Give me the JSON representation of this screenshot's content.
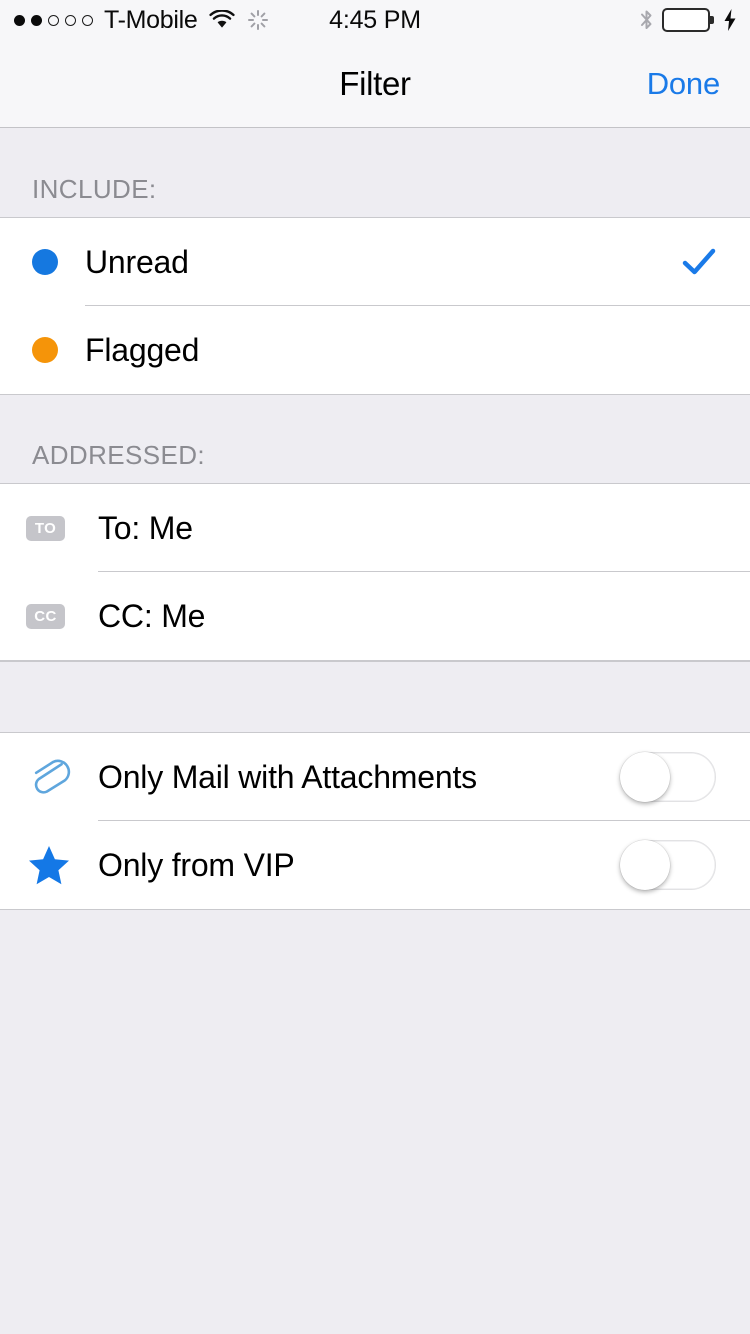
{
  "status_bar": {
    "signal_dots_filled": 2,
    "signal_dots_total": 5,
    "carrier": "T-Mobile",
    "wifi_icon": "wifi-icon",
    "activity_icon": "activity-spinner-icon",
    "time": "4:45 PM",
    "bluetooth_icon": "bluetooth-icon",
    "battery_icon": "battery-icon",
    "battery_charging_icon": "charging-bolt-icon",
    "battery_color": "#4cd964"
  },
  "nav": {
    "title": "Filter",
    "done_label": "Done",
    "accent_color": "#1a7ae8"
  },
  "sections": [
    {
      "header": "INCLUDE:",
      "rows": [
        {
          "icon": "blue-dot-icon",
          "label": "Unread",
          "accessory": "checkmark",
          "selected": true,
          "color": "#1578e0"
        },
        {
          "icon": "orange-dot-icon",
          "label": "Flagged",
          "accessory": "none",
          "selected": false,
          "color": "#f59409"
        }
      ]
    },
    {
      "header": "ADDRESSED:",
      "rows": [
        {
          "icon": "to-badge-icon",
          "badge": "TO",
          "label": "To: Me",
          "accessory": "none",
          "selected": false
        },
        {
          "icon": "cc-badge-icon",
          "badge": "CC",
          "label": "CC: Me",
          "accessory": "none",
          "selected": false
        }
      ]
    },
    {
      "header": "",
      "rows": [
        {
          "icon": "paperclip-icon",
          "label": "Only Mail with Attachments",
          "accessory": "switch",
          "switch_on": false
        },
        {
          "icon": "star-icon",
          "label": "Only from VIP",
          "accessory": "switch",
          "switch_on": false
        }
      ]
    }
  ],
  "colors": {
    "group_background": "#eeedf2",
    "row_background": "#ffffff",
    "separator": "#c9c9cd",
    "header_text": "#8b8b91",
    "badge_background": "#c5c5ca"
  }
}
